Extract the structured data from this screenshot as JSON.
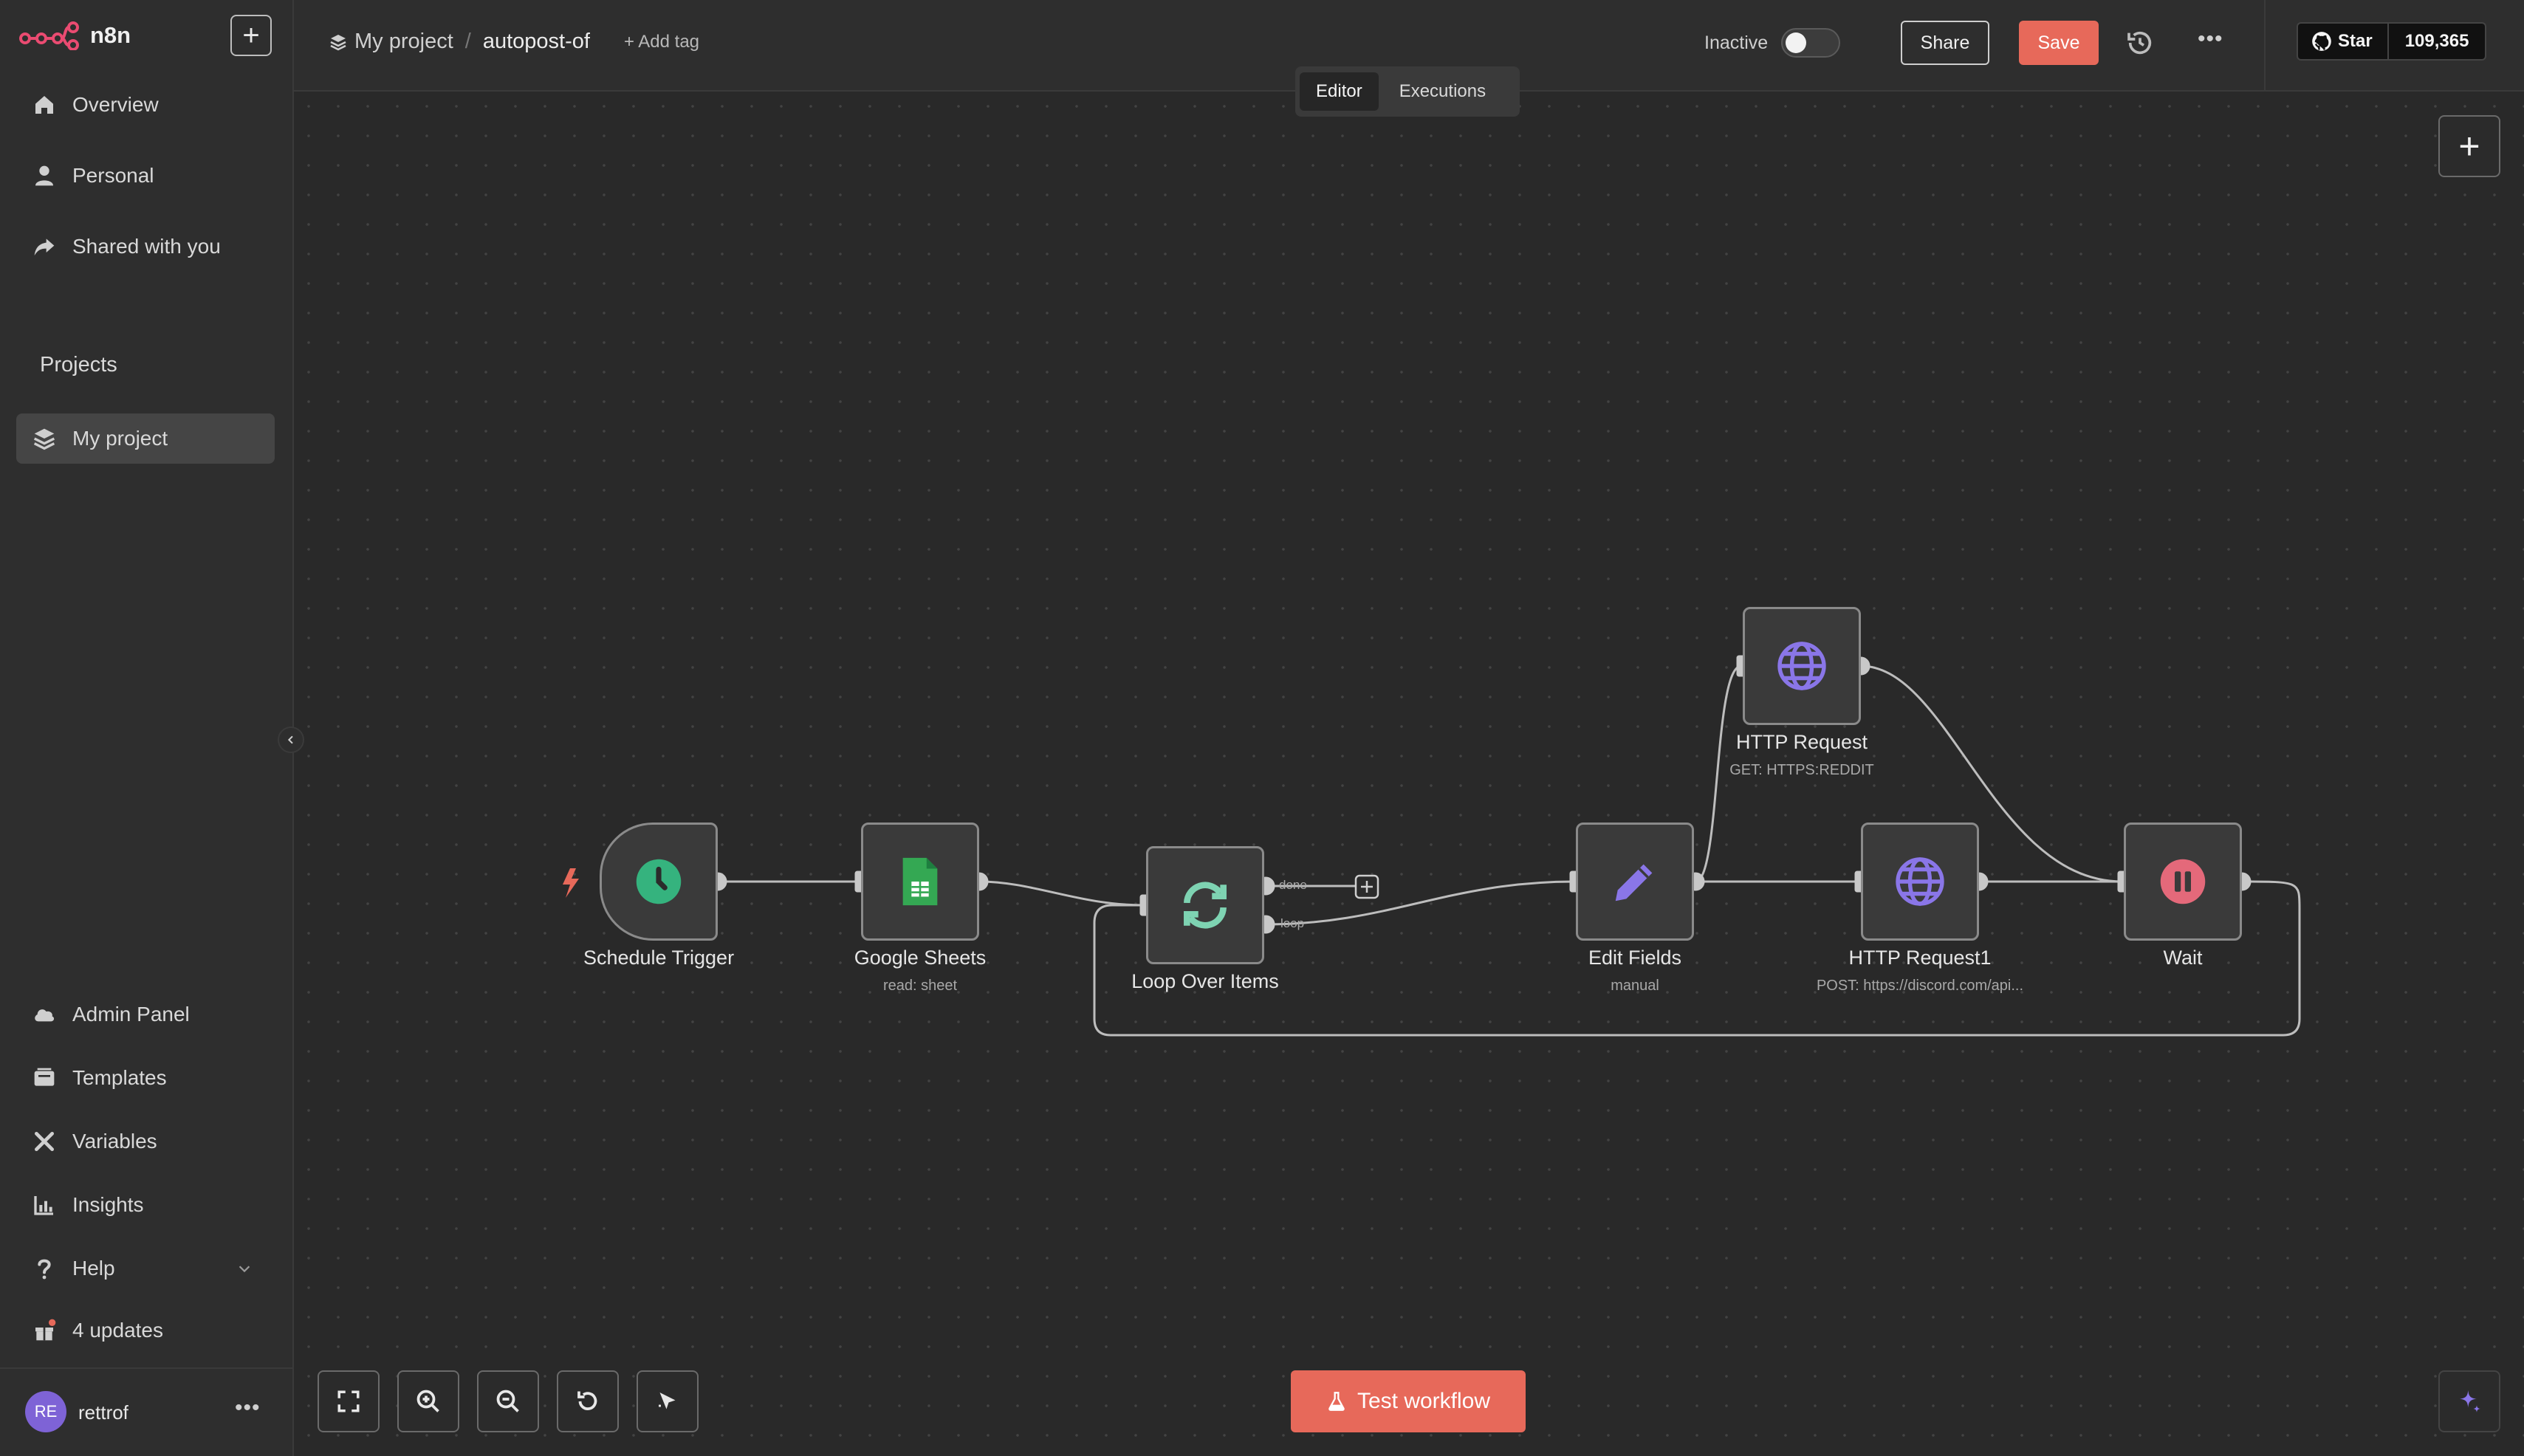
{
  "app": {
    "name": "n8n"
  },
  "sidebar": {
    "nav": [
      {
        "label": "Overview",
        "icon": "home-icon"
      },
      {
        "label": "Personal",
        "icon": "user-icon"
      },
      {
        "label": "Shared with you",
        "icon": "share-icon"
      }
    ],
    "projects_heading": "Projects",
    "projects": [
      {
        "label": "My project",
        "icon": "layers-icon",
        "active": true
      }
    ],
    "bottom_nav": [
      {
        "label": "Admin Panel",
        "icon": "cloud-icon"
      },
      {
        "label": "Templates",
        "icon": "templates-icon"
      },
      {
        "label": "Variables",
        "icon": "variables-icon"
      },
      {
        "label": "Insights",
        "icon": "chart-icon"
      },
      {
        "label": "Help",
        "icon": "help-icon"
      },
      {
        "label": "4 updates",
        "icon": "gift-icon"
      }
    ],
    "user": {
      "initials": "RE",
      "name": "rettrof",
      "more": "•••"
    }
  },
  "header": {
    "project": "My project",
    "separator": "/",
    "workflow_name": "autopost-of",
    "add_tag": "+ Add tag",
    "status_label": "Inactive",
    "active": false,
    "share_label": "Share",
    "save_label": "Save",
    "more": "•••",
    "github": {
      "star_label": "Star",
      "count": "109,365"
    }
  },
  "tabs": [
    {
      "label": "Editor",
      "active": true
    },
    {
      "label": "Executions",
      "active": false
    }
  ],
  "workflow": {
    "nodes": [
      {
        "id": "schedule",
        "name": "Schedule Trigger",
        "subtitle": "",
        "icon": "clock-icon",
        "color": "#35b37e"
      },
      {
        "id": "sheets",
        "name": "Google Sheets",
        "subtitle": "read: sheet",
        "icon": "google-sheets-icon",
        "color": "#34a853"
      },
      {
        "id": "loop",
        "name": "Loop Over Items",
        "subtitle": "",
        "icon": "loop-icon",
        "color": "#7ed3b2",
        "outputs": [
          "done",
          "loop"
        ]
      },
      {
        "id": "edit",
        "name": "Edit Fields",
        "subtitle": "manual",
        "icon": "pencil-icon",
        "color": "#8a76e8"
      },
      {
        "id": "http1",
        "name": "HTTP Request",
        "subtitle": "GET: HTTPS:REDDIT",
        "icon": "globe-icon",
        "color": "#8a76e8"
      },
      {
        "id": "http2",
        "name": "HTTP Request1",
        "subtitle": "POST: https://discord.com/api...",
        "icon": "globe-icon",
        "color": "#8a76e8"
      },
      {
        "id": "wait",
        "name": "Wait",
        "subtitle": "",
        "icon": "pause-icon",
        "color": "#e4697a"
      }
    ]
  },
  "footer": {
    "test_label": "Test workflow"
  },
  "colors": {
    "accent": "#e7695a",
    "canvas": "#292929",
    "sidebar": "#2e2e2e"
  }
}
